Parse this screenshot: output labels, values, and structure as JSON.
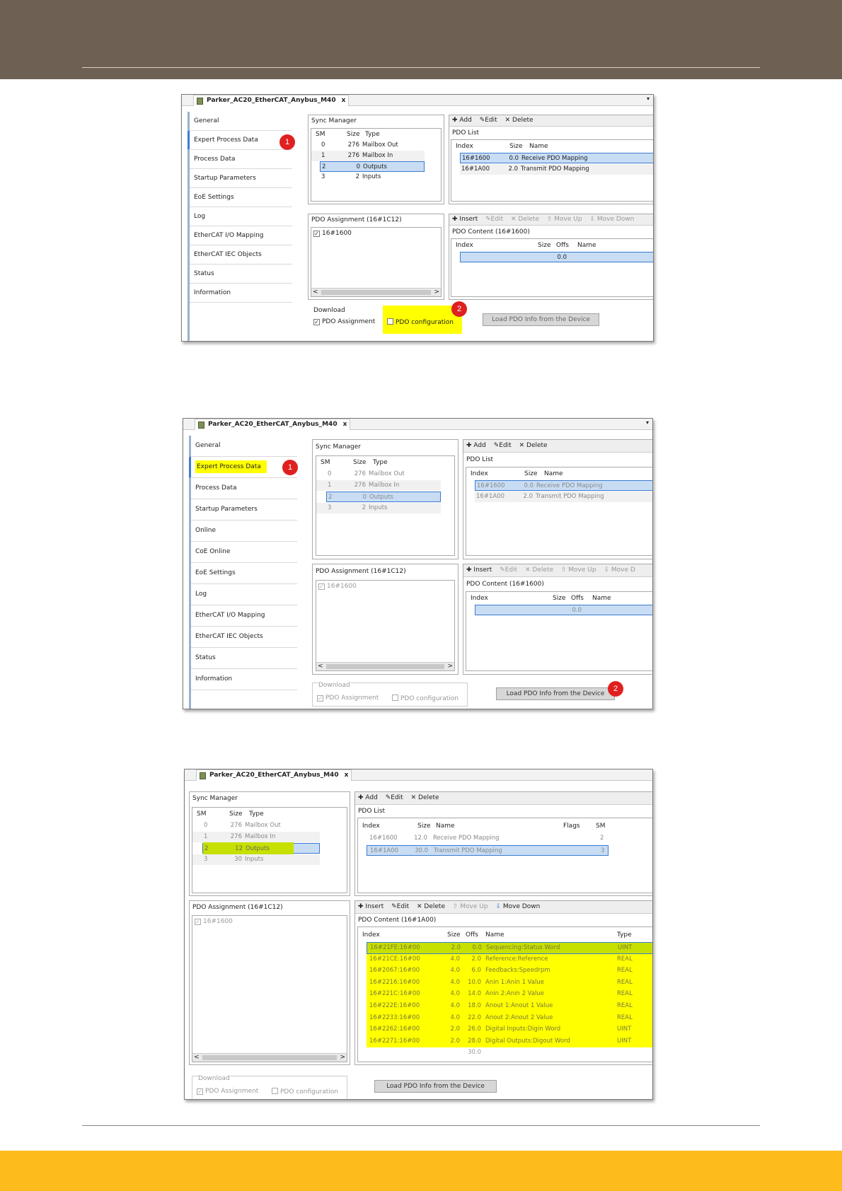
{
  "window": {
    "doc_title": "Parker_AC20_EtherCAT_Anybus_M40",
    "close_glyph": "x",
    "dropdown_glyph": "▾"
  },
  "common": {
    "sync_manager_title": "Sync Manager",
    "sm_headers": [
      "SM",
      "Size",
      "Type"
    ],
    "pdo_list_title": "PDO List",
    "pdo_list_headers": [
      "Index",
      "Size",
      "Name"
    ],
    "pdo_assignment_title": "PDO Assignment (16#1C12)",
    "toolbar_top": [
      "Add",
      "Edit",
      "Delete"
    ],
    "toolbar_content": [
      "Insert",
      "Edit",
      "Delete",
      "Move Up",
      "Move Down"
    ],
    "content_headers": [
      "Index",
      "Size",
      "Offs",
      "Name"
    ],
    "download_label": "Download",
    "pdo_assignment_chk": "PDO Assignment",
    "pdo_configuration_chk": "PDO configuration",
    "load_button": "Load PDO Info from the Device",
    "check_glyph": "✓",
    "scroll_left": "<",
    "scroll_right": ">"
  },
  "shot1": {
    "sidebar": [
      "General",
      "Expert Process Data",
      "Process Data",
      "Startup Parameters",
      "EoE Settings",
      "Log",
      "EtherCAT I/O Mapping",
      "EtherCAT IEC Objects",
      "Status",
      "Information"
    ],
    "sm_rows": [
      {
        "sm": "0",
        "size": "276",
        "type": "Mailbox Out"
      },
      {
        "sm": "1",
        "size": "276",
        "type": "Mailbox In"
      },
      {
        "sm": "2",
        "size": "0",
        "type": "Outputs"
      },
      {
        "sm": "3",
        "size": "2",
        "type": "Inputs"
      }
    ],
    "pdo_list_rows": [
      {
        "index": "16#1600",
        "size": "0.0",
        "name": "Receive PDO Mapping"
      },
      {
        "index": "16#1A00",
        "size": "2.0",
        "name": "Transmit PDO Mapping"
      }
    ],
    "assignment_item": "16#1600",
    "content_title": "PDO Content (16#1600)",
    "content_total": "0.0",
    "badge1": "1",
    "badge2": "2"
  },
  "shot2": {
    "sidebar": [
      "General",
      "Expert Process Data",
      "Process Data",
      "Startup Parameters",
      "Online",
      "CoE Online",
      "EoE Settings",
      "Log",
      "EtherCAT I/O Mapping",
      "EtherCAT IEC Objects",
      "Status",
      "Information"
    ],
    "sm_rows": [
      {
        "sm": "0",
        "size": "276",
        "type": "Mailbox Out"
      },
      {
        "sm": "1",
        "size": "276",
        "type": "Mailbox In"
      },
      {
        "sm": "2",
        "size": "0",
        "type": "Outputs"
      },
      {
        "sm": "3",
        "size": "2",
        "type": "Inputs"
      }
    ],
    "pdo_list_rows": [
      {
        "index": "16#1600",
        "size": "0.0",
        "name": "Receive PDO Mapping"
      },
      {
        "index": "16#1A00",
        "size": "2.0",
        "name": "Transmit PDO Mapping"
      }
    ],
    "assignment_item": "16#1600",
    "content_title": "PDO Content (16#1600)",
    "content_total": "0.0",
    "toolbar_move_down_short": "Move D",
    "badge1": "1",
    "badge2": "2"
  },
  "shot3": {
    "sm_rows": [
      {
        "sm": "0",
        "size": "276",
        "type": "Mailbox Out"
      },
      {
        "sm": "1",
        "size": "276",
        "type": "Mailbox In"
      },
      {
        "sm": "2",
        "size": "12",
        "type": "Outputs"
      },
      {
        "sm": "3",
        "size": "30",
        "type": "Inputs"
      }
    ],
    "pdo_list_headers": [
      "Index",
      "Size",
      "Name",
      "Flags",
      "SM"
    ],
    "pdo_list_rows": [
      {
        "index": "16#1600",
        "size": "12.0",
        "name": "Receive PDO Mapping",
        "flags": "",
        "sm": "2"
      },
      {
        "index": "16#1A00",
        "size": "30.0",
        "name": "Transmit PDO Mapping",
        "flags": "",
        "sm": "3"
      }
    ],
    "assignment_item": "16#1600",
    "content_title": "PDO Content (16#1A00)",
    "content_headers": [
      "Index",
      "Size",
      "Offs",
      "Name",
      "Type"
    ],
    "content_rows": [
      {
        "index": "16#21FE:16#00",
        "size": "2.0",
        "offs": "0.0",
        "name": "Sequencing:Status Word",
        "type": "UINT"
      },
      {
        "index": "16#21CE:16#00",
        "size": "4.0",
        "offs": "2.0",
        "name": "Reference:Reference",
        "type": "REAL"
      },
      {
        "index": "16#2067:16#00",
        "size": "4.0",
        "offs": "6.0",
        "name": "Feedbacks:Speedrpm",
        "type": "REAL"
      },
      {
        "index": "16#2216:16#00",
        "size": "4.0",
        "offs": "10.0",
        "name": "Anin 1:Anin 1 Value",
        "type": "REAL"
      },
      {
        "index": "16#221C:16#00",
        "size": "4.0",
        "offs": "14.0",
        "name": "Anin 2:Anin 2 Value",
        "type": "REAL"
      },
      {
        "index": "16#222E:16#00",
        "size": "4.0",
        "offs": "18.0",
        "name": "Anout 1:Anout 1 Value",
        "type": "REAL"
      },
      {
        "index": "16#2233:16#00",
        "size": "4.0",
        "offs": "22.0",
        "name": "Anout 2:Anout 2 Value",
        "type": "REAL"
      },
      {
        "index": "16#2262:16#00",
        "size": "2.0",
        "offs": "26.0",
        "name": "Digital Inputs:Digin Word",
        "type": "UINT"
      },
      {
        "index": "16#2271:16#00",
        "size": "2.0",
        "offs": "28.0",
        "name": "Digital Outputs:Digout Word",
        "type": "UINT"
      }
    ],
    "content_total": "30.0"
  },
  "colors": {
    "header": "#6e6153",
    "footer": "#fdbb1c",
    "highlight_yellow": "#ffff00",
    "highlight_green": "#c6e000",
    "badge_red": "#e02020",
    "selection_blue": "#c8ddf4"
  },
  "icons": {
    "add": "plus-icon",
    "edit": "pencil-icon",
    "delete": "x-icon",
    "move_up": "arrow-up-icon",
    "move_down": "arrow-down-icon",
    "device": "device-icon"
  }
}
